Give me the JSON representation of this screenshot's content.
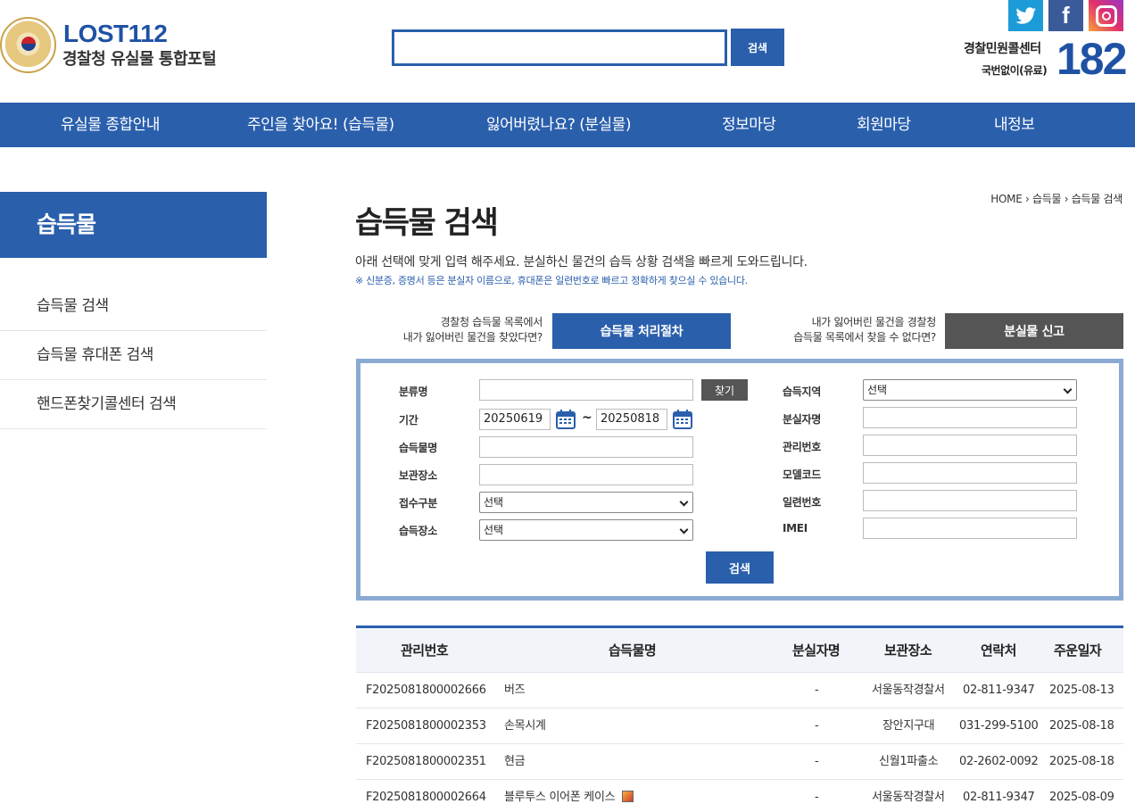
{
  "header": {
    "logo_title": "LOST112",
    "logo_subtitle": "경찰청 유실물 통합포털",
    "search": {
      "value": "",
      "button": "검색"
    },
    "sns": [
      "twitter-icon",
      "facebook-icon",
      "instagram-icon"
    ],
    "callcenter": {
      "title": "경찰민원콜센터",
      "sub": "국번없이(유료)",
      "number": "182"
    }
  },
  "gnb": [
    "유실물 종합안내",
    "주인을 찾아요! (습득물)",
    "잃어버렸나요? (분실물)",
    "정보마당",
    "회원마당",
    "내정보"
  ],
  "sidebar": {
    "title": "습득물",
    "items": [
      "습득물 검색",
      "습득물 휴대폰 검색",
      "핸드폰찾기콜센터 검색"
    ]
  },
  "content": {
    "breadcrumb": [
      "HOME",
      "습득물",
      "습득물 검색"
    ],
    "title": "습득물 검색",
    "desc": "아래 선택에 맞게 입력 해주세요. 분실하신 물건의 습득 상황 검색을 빠르게 도와드립니다.",
    "note": "※ 신분증, 증명서 등은 분실자 이름으로, 휴대폰은 일련번호로 빠르고 정확하게 찾으실 수 있습니다.",
    "guide_left": {
      "line1": "경찰청 습득물 목록에서",
      "line2": "내가 잃어버린 물건을 찾았다면?",
      "button": "습득물 처리절차"
    },
    "guide_right": {
      "line1": "내가 잃어버린 물건을 경찰청",
      "line2": "습득물 목록에서 찾을 수 없다면?",
      "button": "분실물 신고"
    }
  },
  "form": {
    "category": {
      "label": "분류명",
      "value": "",
      "find": "찾기"
    },
    "period": {
      "label": "기간",
      "from": "20250619",
      "to": "20250818",
      "sep": "~"
    },
    "item_name": {
      "label": "습득물명",
      "value": ""
    },
    "storage": {
      "label": "보관장소",
      "value": ""
    },
    "receipt_type": {
      "label": "접수구분",
      "value": "선택"
    },
    "found_place": {
      "label": "습득장소",
      "value": "선택"
    },
    "region": {
      "label": "습득지역",
      "value": "선택"
    },
    "owner": {
      "label": "분실자명",
      "value": ""
    },
    "manage_no": {
      "label": "관리번호",
      "value": ""
    },
    "model": {
      "label": "모델코드",
      "value": ""
    },
    "serial": {
      "label": "일련번호",
      "value": ""
    },
    "imei": {
      "label": "IMEI",
      "value": ""
    },
    "search_button": "검색"
  },
  "table": {
    "headers": [
      "관리번호",
      "습득물명",
      "분실자명",
      "보관장소",
      "연락처",
      "주운일자"
    ],
    "rows": [
      [
        "F2025081800002666",
        "버즈",
        "-",
        "서울동작경찰서",
        "02-811-9347",
        "2025-08-13"
      ],
      [
        "F2025081800002353",
        "손목시계",
        "-",
        "장안지구대",
        "031-299-5100",
        "2025-08-18"
      ],
      [
        "F2025081800002351",
        "현금",
        "-",
        "신월1파출소",
        "02-2602-0092",
        "2025-08-18"
      ],
      [
        "F2025081800002664",
        "블루투스 이어폰 케이스",
        "-",
        "서울동작경찰서",
        "02-811-9347",
        "2025-08-09"
      ]
    ]
  }
}
